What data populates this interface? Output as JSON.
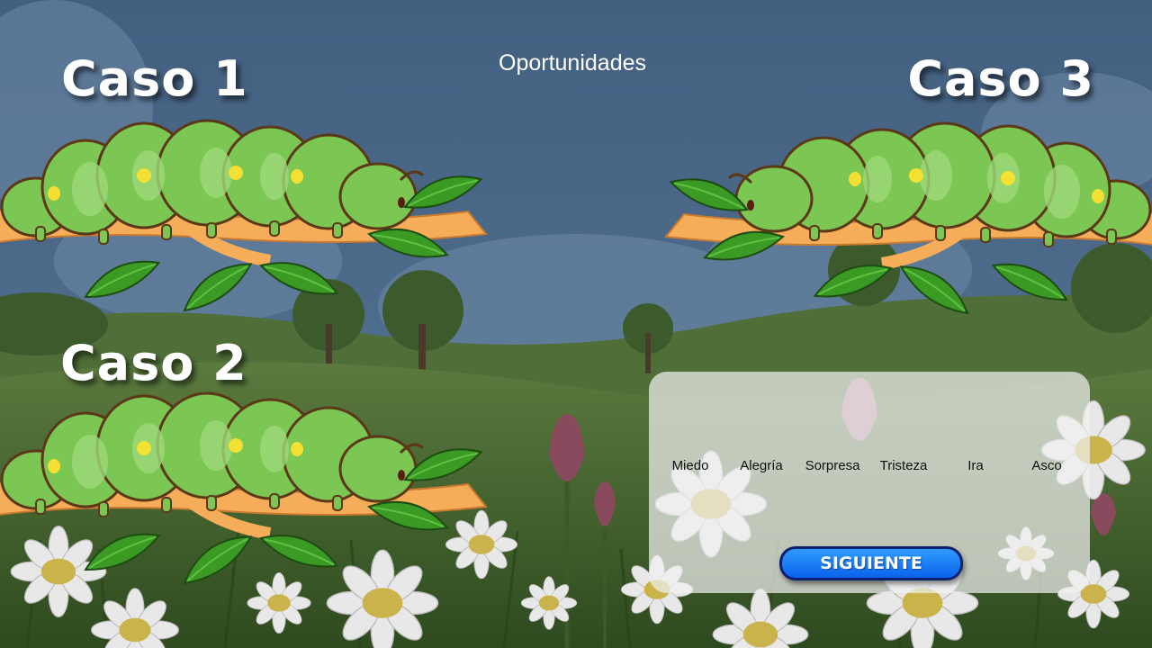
{
  "header": {
    "attempts_label": "Oportunidades"
  },
  "cases": [
    {
      "id": "case-1",
      "label": "Caso 1"
    },
    {
      "id": "case-2",
      "label": "Caso 2"
    },
    {
      "id": "case-3",
      "label": "Caso 3"
    }
  ],
  "panel": {
    "emotions": [
      "Miedo",
      "Alegría",
      "Sorpresa",
      "Tristeza",
      "Ira",
      "Asco"
    ],
    "next_label": "SIGUIENTE"
  },
  "colors": {
    "sky": "#4a6688",
    "hill_dark": "#3d5a2c",
    "caterpillar": "#7cc653",
    "branch": "#f5ad5a",
    "leaf": "#3a9a24",
    "button": "#1a7df5"
  }
}
